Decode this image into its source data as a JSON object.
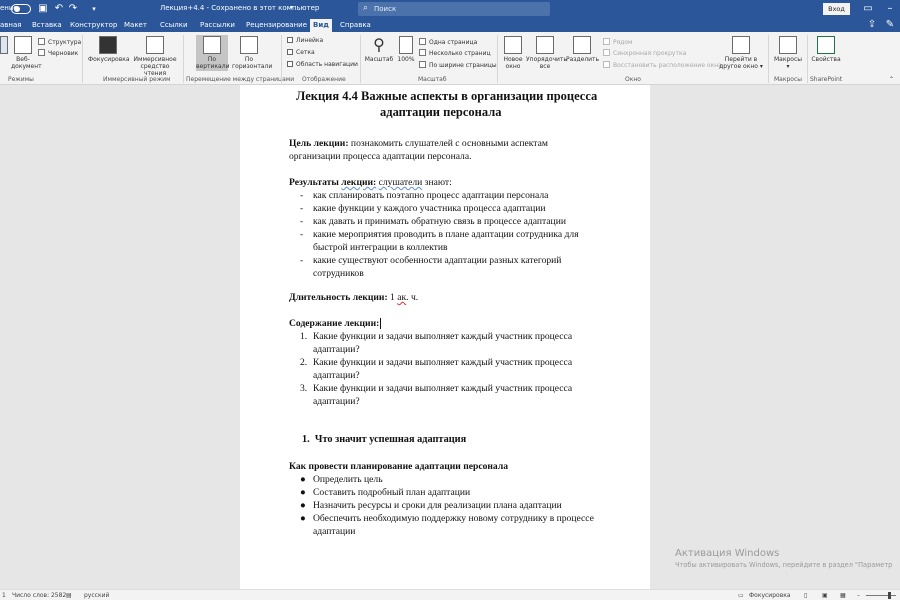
{
  "titlebar": {
    "autosave_label": "ение",
    "doc_title": "Лекция+4.4  -  Сохранено в этот компьютер",
    "search_placeholder": "Поиск",
    "login_button": "Вход"
  },
  "tabs": [
    "авная",
    "Вставка",
    "Конструктор",
    "Макет",
    "Ссылки",
    "Рассылки",
    "Рецензирование",
    "Вид",
    "Справка"
  ],
  "active_tab": "Вид",
  "ribbon": {
    "modes": {
      "web": "Веб-\nдокумент",
      "structure": "Структура",
      "draft": "Черновик",
      "group": "Режимы"
    },
    "immersive": {
      "focus": "Фокусировка",
      "reader": "Иммерсивное\nсредство чтения",
      "group": "Иммерсивный режим"
    },
    "page_move": {
      "vertical": "По\nвертикали",
      "horizontal": "По\nгоризонтали",
      "group": "Перемещение между страницами"
    },
    "show": {
      "ruler": "Линейка",
      "grid": "Сетка",
      "nav": "Область навигации",
      "group": "Отображение"
    },
    "zoom": {
      "zoom": "Масштаб",
      "percent": "100%",
      "one_page": "Одна страница",
      "multi_page": "Несколько страниц",
      "page_width": "По ширине страницы",
      "group": "Масштаб"
    },
    "window": {
      "new": "Новое\nокно",
      "arrange": "Упорядочить\nвсе",
      "split": "Разделить",
      "side_by_side": "Рядом",
      "sync_scroll": "Синхронная прокрутка",
      "reset": "Восстановить расположение окна",
      "switch": "Перейти в\nдругое окно",
      "group": "Окно"
    },
    "macros": {
      "label": "Макросы",
      "group": "Макросы"
    },
    "sharepoint": {
      "label": "Свойства",
      "group": "SharePoint"
    }
  },
  "document": {
    "title_l1": "Лекция 4.4 Важные аспекты в организации процесса",
    "title_l2": "адаптации персонала",
    "goal_label": "Цель лекции:",
    "goal_text_1": " познакомить слушателей с основными аспектам",
    "goal_text_2": "организации процесса адаптации персонала.",
    "results_label_1": "Результаты ",
    "results_label_2": "лекции:",
    "results_after_1": "  ",
    "results_after_2": "слушатели",
    "results_after_3": " знают:",
    "results_items": [
      [
        "как спланировать поэтапно процесс адаптации персонала"
      ],
      [
        "какие функции у каждого участника процесса адаптации"
      ],
      [
        "как давать и принимать обратную связь в процессе адаптации"
      ],
      [
        "какие мероприятия проводить в плане адаптации сотрудника для",
        "быстрой интеграции в коллектив"
      ],
      [
        "какие существуют особенности адаптации разных категорий",
        "сотрудников"
      ]
    ],
    "duration_label": "Длительность лекции:",
    "duration_pre": " 1 ",
    "duration_ak": "ак",
    "duration_post": ". ч.",
    "content_label": "Содержание лекции:",
    "content_items": [
      [
        "Какие функции и задачи выполняет каждый участник процесса",
        "адаптации?"
      ],
      [
        "Какие функции и задачи выполняет каждый участник процесса",
        "адаптации?"
      ],
      [
        "Какие функции и задачи выполняет каждый участник процесса",
        "адаптации?"
      ]
    ],
    "section_num": "1.",
    "section_title": "Что значит успешная адаптация",
    "subsection": "Как провести планирование адаптации персонала",
    "bullets": [
      [
        "Определить цель"
      ],
      [
        "Составить подробный план адаптации"
      ],
      [
        "Назначить ресурсы и сроки для реализации плана адаптации"
      ],
      [
        "Обеспечить необходимую поддержку новому сотруднику в процессе",
        "адаптации"
      ]
    ]
  },
  "statusbar": {
    "page": "1",
    "words": "Число слов: 2582",
    "lang": "русский",
    "focus": "Фокусировка"
  },
  "watermark": {
    "line1": "Активация Windows",
    "line2": "Чтобы активировать Windows, перейдите в раздел \"Параметр"
  }
}
